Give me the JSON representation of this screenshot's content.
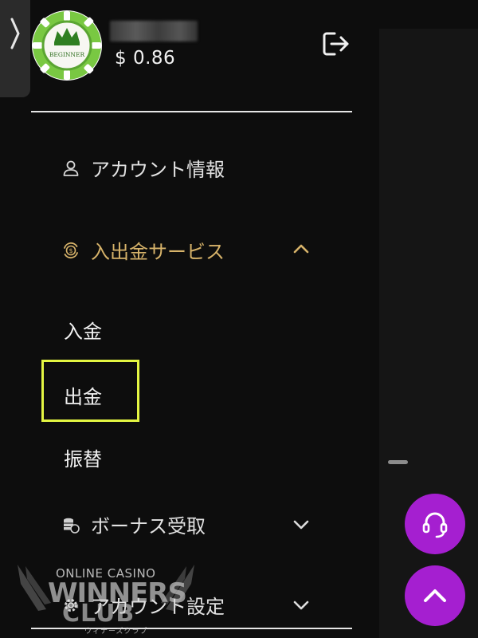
{
  "user": {
    "avatar_badge_text": "BEGINNER",
    "balance": "$ 0.86"
  },
  "menu": {
    "account_info": "アカウント情報",
    "payment_services": "入出金サービス",
    "payment_submenu": [
      "入金",
      "出金",
      "振替"
    ],
    "bonus": "ボーナス受取",
    "account_settings": "アカウント設定"
  },
  "watermark": {
    "line1": "ONLINE CASINO",
    "line2": "WINNERS",
    "line3": "CLUB",
    "line4": "ウィナーズクラブ"
  },
  "icons": {
    "expand": "chevron-right-icon",
    "logout": "logout-icon",
    "account": "user-icon",
    "payments": "dollar-cycle-icon",
    "bonus": "coins-icon",
    "settings": "gear-icon",
    "support": "headset-icon",
    "top": "arrow-up-icon"
  },
  "colors": {
    "background": "#0d0d0d",
    "active": "#d7b36a",
    "highlight": "#e3f542",
    "fab": "#a51fd0",
    "avatar_green": "#7ac943"
  }
}
